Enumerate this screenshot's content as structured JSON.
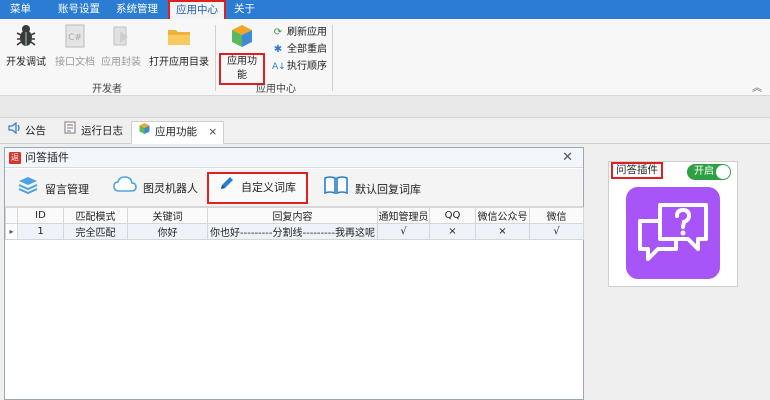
{
  "menubar": {
    "items": [
      "菜单",
      "账号设置",
      "系统管理",
      "应用中心",
      "关于"
    ],
    "active_index": 3
  },
  "ribbon": {
    "developer": {
      "buttons": [
        {
          "label": "开发调试",
          "icon": "bug-icon",
          "enabled": true
        },
        {
          "label": "接口文档",
          "icon": "csharp-doc-icon",
          "enabled": false
        },
        {
          "label": "应用封装",
          "icon": "package-icon",
          "enabled": false
        },
        {
          "label": "打开应用目录",
          "icon": "folder-icon",
          "enabled": true
        }
      ],
      "group_label": "开发者"
    },
    "app_center": {
      "big_button": {
        "label": "应用功能",
        "icon": "cube-icon"
      },
      "small_buttons": [
        {
          "label": "刷新应用",
          "icon": "refresh-icon"
        },
        {
          "label": "全部重启",
          "icon": "restart-icon"
        },
        {
          "label": "执行顺序",
          "icon": "sort-order-icon"
        }
      ],
      "group_label": "应用中心"
    },
    "collapse_glyph": "︽"
  },
  "doc_tabs": [
    {
      "label": "公告",
      "icon": "speaker-icon"
    },
    {
      "label": "运行日志",
      "icon": "log-icon"
    },
    {
      "label": "应用功能",
      "icon": "cube-icon",
      "active": true,
      "close": "×"
    }
  ],
  "plugin_window": {
    "title": "问答插件",
    "title_icon_glyph": "返",
    "close_glyph": "✕",
    "toolbar": [
      {
        "label": "留言管理",
        "icon": "layers-icon"
      },
      {
        "label": "图灵机器人",
        "icon": "cloud-icon"
      },
      {
        "label": "自定义词库",
        "icon": "pencil-icon",
        "active": true
      },
      {
        "label": "默认回复词库",
        "icon": "book-icon"
      }
    ],
    "grid": {
      "columns": [
        "ID",
        "匹配模式",
        "关键词",
        "回复内容",
        "通知管理员",
        "QQ",
        "微信公众号",
        "微信"
      ],
      "row_marker": "▸",
      "rows": [
        [
          "1",
          "完全匹配",
          "你好",
          "你也好---------分割线---------我再这呢",
          "√",
          "×",
          "×",
          "√"
        ]
      ]
    }
  },
  "app_card": {
    "label": "问答插件",
    "toggle_label": "开启",
    "toggle_on": true,
    "tile_color": "#a855f7",
    "tile_icon": "chat-question-icon"
  },
  "colors": {
    "menubar": "#2b7cd3",
    "highlight_border": "#e02020",
    "toggle_on": "#2ea043"
  }
}
